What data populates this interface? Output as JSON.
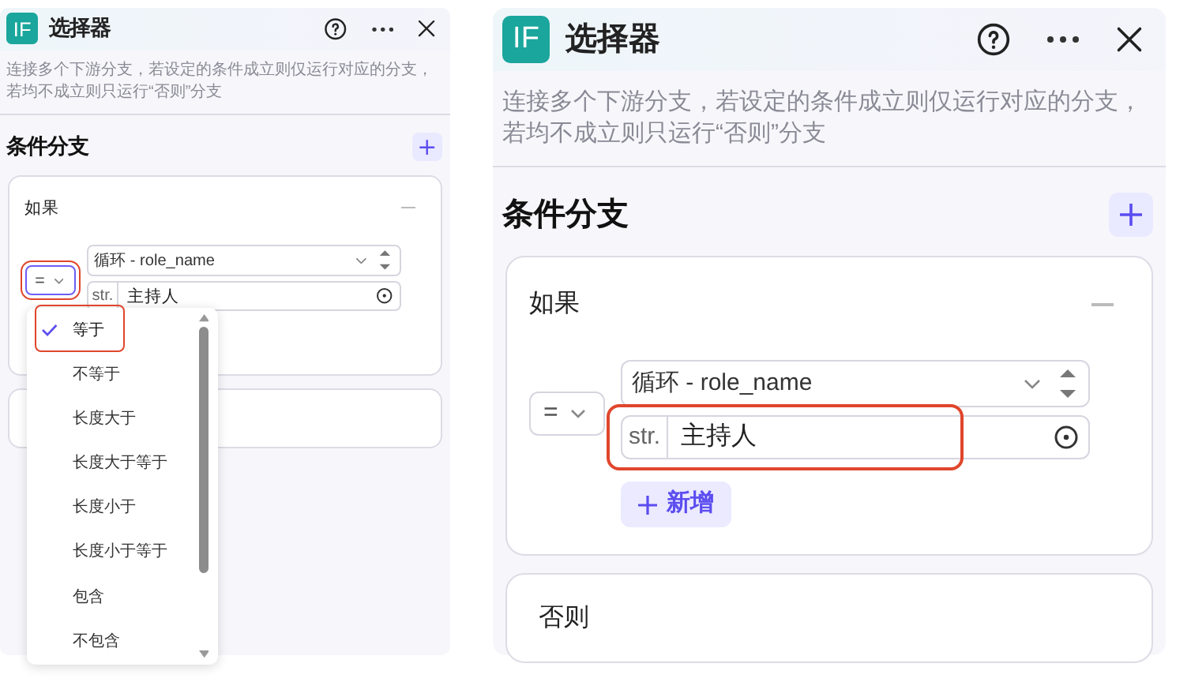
{
  "panels": [
    {
      "logo": "IF",
      "title": "选择器",
      "description": "连接多个下游分支，若设定的条件成立则仅运行对应的分支，若均不成立则只运行“否则”分支",
      "section_title": "条件分支",
      "if_branch": {
        "label": "如果",
        "operator": {
          "symbol": "=",
          "open": true,
          "highlighted": true
        },
        "variable": "循环 - role_name",
        "value_type": "str.",
        "value": "主持人",
        "value_highlighted": false
      },
      "dropdown": {
        "options": [
          {
            "label": "等于",
            "selected": true,
            "highlighted": true
          },
          {
            "label": "不等于",
            "selected": false,
            "highlighted": false
          },
          {
            "label": "长度大于",
            "selected": false,
            "highlighted": false
          },
          {
            "label": "长度大于等于",
            "selected": false,
            "highlighted": false
          },
          {
            "label": "长度小于",
            "selected": false,
            "highlighted": false
          },
          {
            "label": "长度小于等于",
            "selected": false,
            "highlighted": false
          },
          {
            "label": "包含",
            "selected": false,
            "highlighted": false
          },
          {
            "label": "不包含",
            "selected": false,
            "highlighted": false
          }
        ]
      }
    },
    {
      "logo": "IF",
      "title": "选择器",
      "description": "连接多个下游分支，若设定的条件成立则仅运行对应的分支，若均不成立则只运行“否则”分支",
      "section_title": "条件分支",
      "if_branch": {
        "label": "如果",
        "operator": {
          "symbol": "=",
          "open": false,
          "highlighted": false
        },
        "variable": "循环 - role_name",
        "value_type": "str.",
        "value": "主持人",
        "value_highlighted": true,
        "add_label": "新增"
      },
      "else_label": "否则"
    }
  ]
}
